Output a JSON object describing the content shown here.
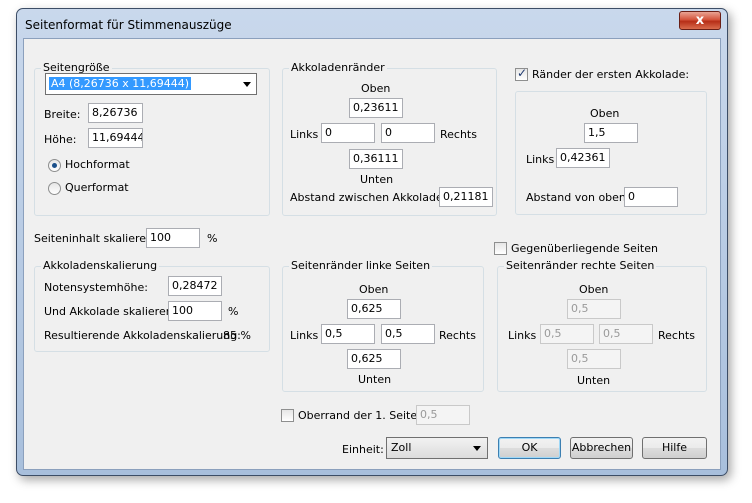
{
  "window": {
    "title": "Seitenformat für Stimmenauszüge",
    "close_glyph": "x"
  },
  "seitengroesse": {
    "label": "Seitengröße",
    "selected": "A4 (8,26736 x 11,69444)",
    "breite_label": "Breite:",
    "breite_value": "8,26736",
    "hoehe_label": "Höhe:",
    "hoehe_value": "11,69444",
    "hochformat": "Hochformat",
    "querformat": "Querformat"
  },
  "akkoladenraender": {
    "label": "Akkoladenränder",
    "oben_label": "Oben",
    "oben_value": "0,23611",
    "links_label": "Links",
    "links_value": "0",
    "rechts_value": "0",
    "rechts_label": "Rechts",
    "unten_value": "0,36111",
    "unten_label": "Unten",
    "abstand_label": "Abstand zwischen Akkoladen:",
    "abstand_value": "0,21181"
  },
  "erste_akkolade": {
    "checkbox_label": "Ränder der ersten Akkolade:",
    "oben_label": "Oben",
    "oben_value": "1,5",
    "links_label": "Links",
    "links_value": "0,42361",
    "abstand_label": "Abstand von oben:",
    "abstand_value": "0"
  },
  "skalieren": {
    "label": "Seiteninhalt skalieren:",
    "value": "100",
    "unit": "%"
  },
  "akkoladenskalierung": {
    "label": "Akkoladenskalierung",
    "notensystem_label": "Notensystemhöhe:",
    "notensystem_value": "0,28472",
    "und_label": "Und Akkolade skalieren:",
    "und_value": "100",
    "und_unit": "%",
    "resultierend_label": "Resultierende Akkoladenskalierung:",
    "resultierend_value": "85 %"
  },
  "linke_seiten": {
    "label": "Seitenränder linke Seiten",
    "oben_label": "Oben",
    "oben_value": "0,625",
    "links_label": "Links",
    "links_value": "0,5",
    "rechts_value": "0,5",
    "rechts_label": "Rechts",
    "unten_value": "0,625",
    "unten_label": "Unten"
  },
  "gegenueber": {
    "label": "Gegenüberliegende Seiten"
  },
  "rechte_seiten": {
    "label": "Seitenränder rechte Seiten",
    "oben_label": "Oben",
    "oben_value": "0,5",
    "links_label": "Links",
    "links_value": "0,5",
    "rechts_value": "0,5",
    "rechts_label": "Rechts",
    "unten_value": "0,5",
    "unten_label": "Unten"
  },
  "oberrand": {
    "label": "Oberrand der 1. Seite:",
    "value": "0,5"
  },
  "footer": {
    "einheit_label": "Einheit:",
    "einheit_value": "Zoll",
    "ok": "OK",
    "abbrechen": "Abbrechen",
    "hilfe": "Hilfe"
  }
}
